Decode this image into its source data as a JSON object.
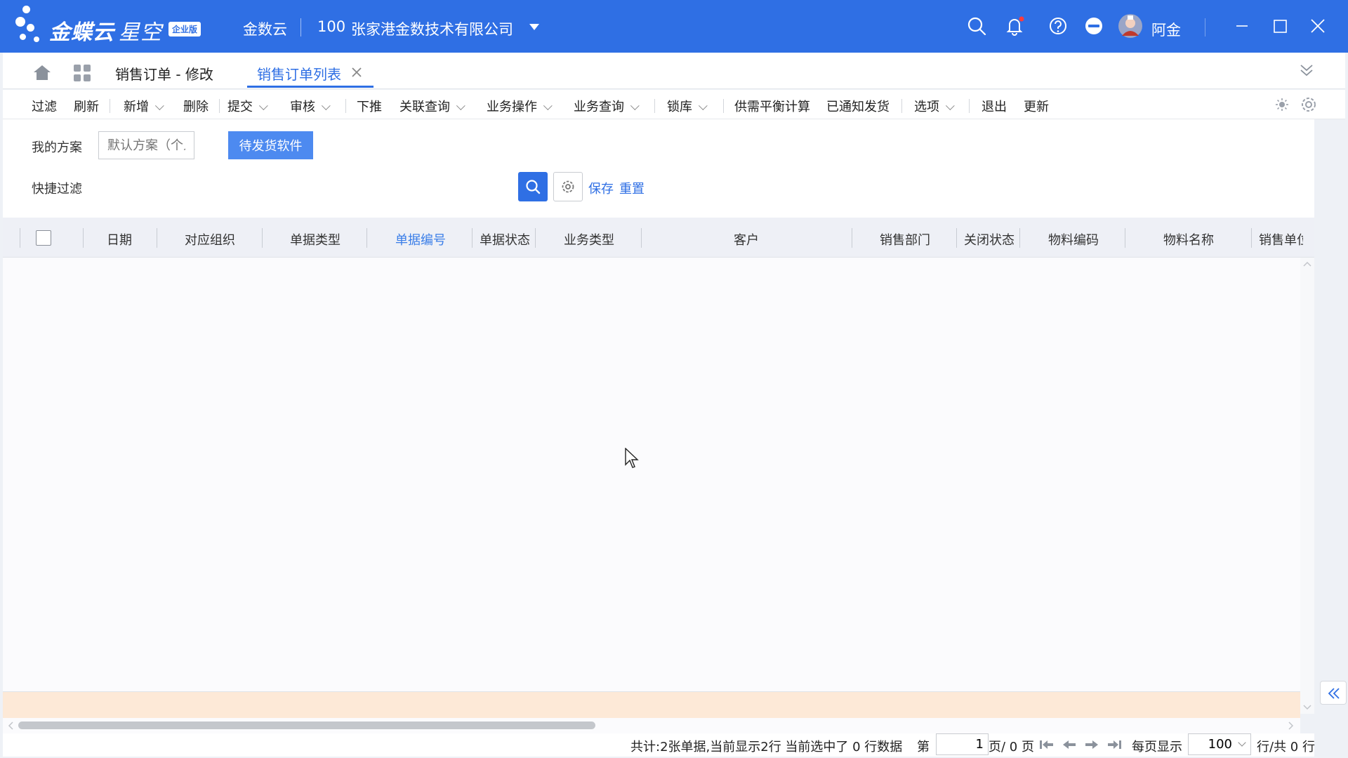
{
  "titlebar": {
    "brand": "金蝶云",
    "brand_sub": "星空",
    "badge": "企业版",
    "org_group": "金数云",
    "org_code": "100",
    "org_name": "张家港金数技术有限公司",
    "user_name": "阿金",
    "icons": [
      "search-icon",
      "bell-icon",
      "help-icon",
      "minus-circle-icon",
      "avatar",
      "minimize-icon",
      "maximize-icon",
      "close-icon"
    ]
  },
  "tabs": [
    {
      "label": "销售订单 - 修改",
      "active": false
    },
    {
      "label": "销售订单列表",
      "active": true
    }
  ],
  "toolbar": {
    "items": [
      {
        "label": "过滤"
      },
      {
        "label": "刷新"
      },
      {
        "label": "新增"
      },
      {
        "label": "删除"
      },
      {
        "label": "提交"
      },
      {
        "label": "审核"
      },
      {
        "label": "下推"
      },
      {
        "label": "关联查询"
      },
      {
        "label": "业务操作"
      },
      {
        "label": "业务查询"
      },
      {
        "label": "锁库"
      },
      {
        "label": "供需平衡计算"
      },
      {
        "label": "已通知发货"
      },
      {
        "label": "选项"
      },
      {
        "label": "退出"
      },
      {
        "label": "更新"
      }
    ]
  },
  "filter": {
    "scheme_label": "我的方案",
    "scheme_placeholder": "默认方案（个人）",
    "scheme_button": "待发货软件",
    "quick_filter_label": "快捷过滤",
    "save_link": "保存",
    "reset_link": "重置"
  },
  "grid": {
    "columns": [
      "日期",
      "对应组织",
      "单据类型",
      "单据编号",
      "单据状态",
      "业务类型",
      "客户",
      "销售部门",
      "关闭状态",
      "物料编码",
      "物料名称",
      "销售单位"
    ],
    "active_column": "单据编号"
  },
  "footer": {
    "summary": "共计:2张单据,当前显示2行 当前选中了 0 行数据",
    "page_prefix": "第",
    "page_value": "1",
    "page_suffix": "页/ 0 页",
    "per_page_label": "每页显示",
    "per_page_value": "100",
    "rows_suffix": "行/共 0 行"
  },
  "colors": {
    "primary": "#2f6fe4",
    "summary_row": "#fde9d7"
  }
}
